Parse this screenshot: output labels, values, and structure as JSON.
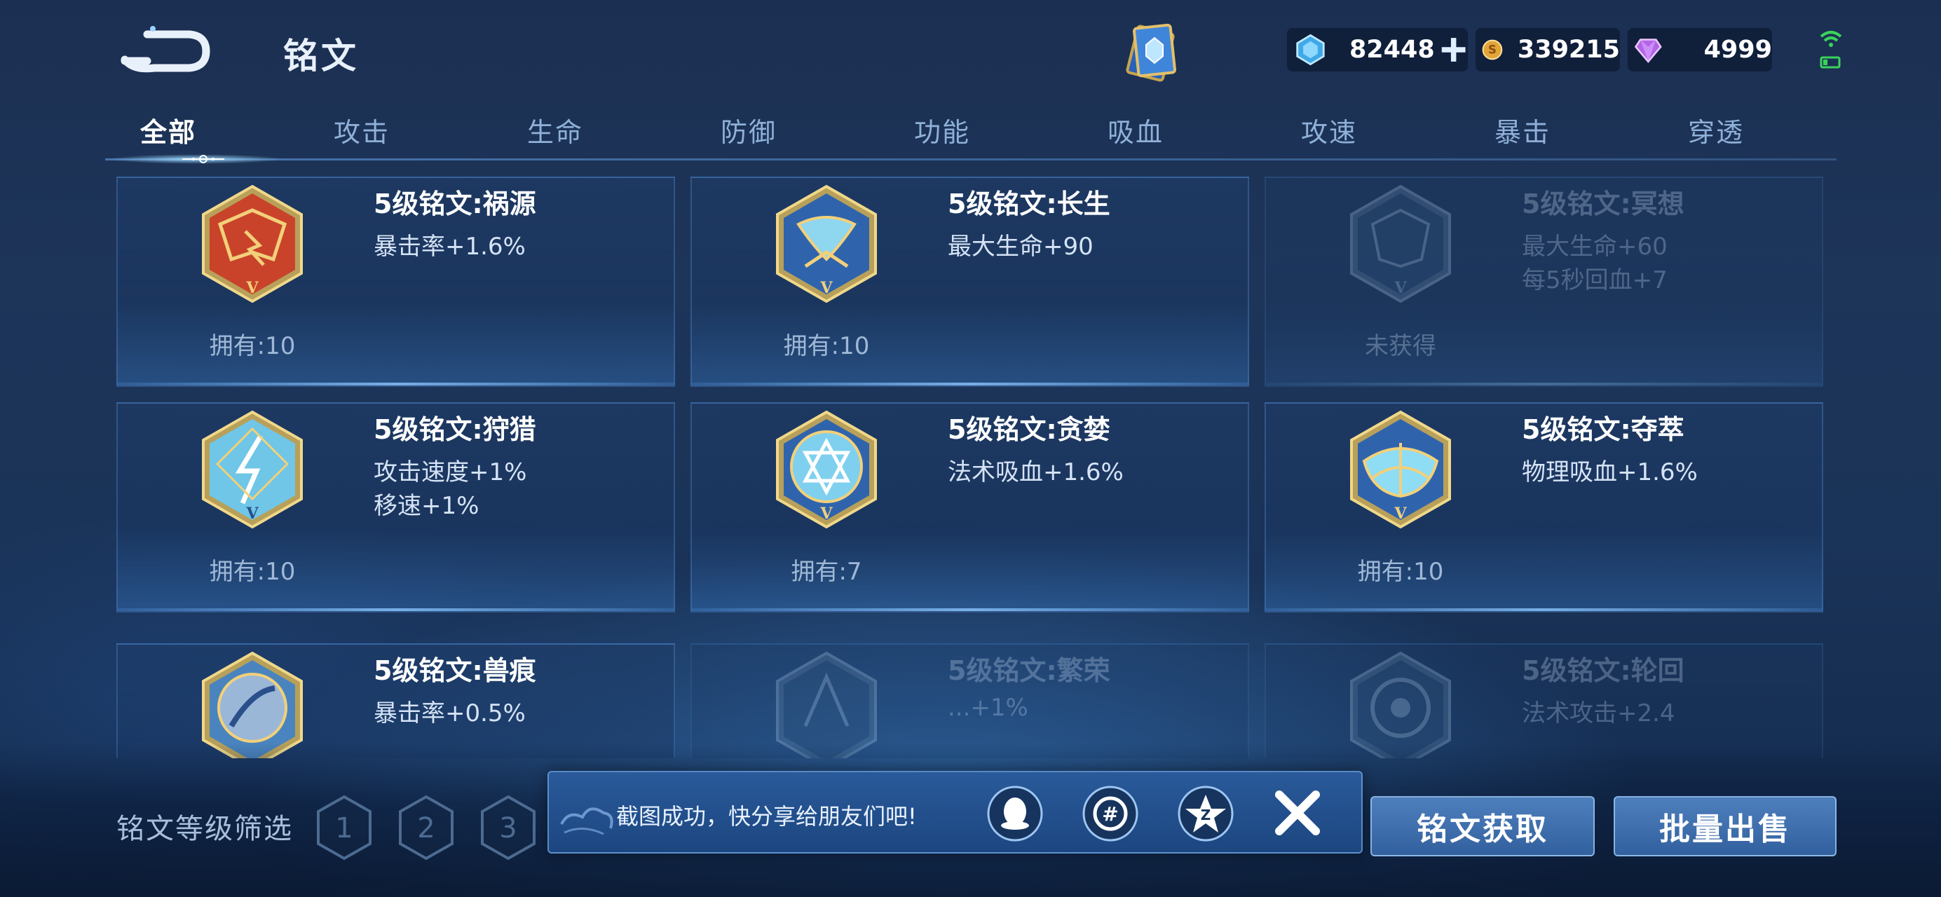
{
  "header": {
    "title": "铭文",
    "currencies": [
      {
        "name": "diamond",
        "value": "82448",
        "icon": "diamond-icon",
        "has_add": true
      },
      {
        "name": "gold",
        "value": "339215",
        "icon": "gold-coin-icon",
        "has_add": false
      },
      {
        "name": "gem",
        "value": "4999",
        "icon": "gem-icon",
        "has_add": false
      }
    ]
  },
  "tabs": [
    "全部",
    "攻击",
    "生命",
    "防御",
    "功能",
    "吸血",
    "攻速",
    "暴击",
    "穿透"
  ],
  "active_tab": "全部",
  "runes": [
    {
      "name": "5级铭文:祸源",
      "stats": [
        "暴击率+1.6%"
      ],
      "owned": "拥有:10",
      "color": "#c9432a"
    },
    {
      "name": "5级铭文:长生",
      "stats": [
        "最大生命+90"
      ],
      "owned": "拥有:10",
      "color": "#3a6fb8"
    },
    {
      "name": "5级铭文:冥想",
      "stats": [
        "最大生命+60",
        "每5秒回血+7"
      ],
      "owned": "未获得",
      "color": "#2f5b8f"
    },
    {
      "name": "5级铭文:狩猎",
      "stats": [
        "攻击速度+1%",
        "移速+1%"
      ],
      "owned": "拥有:10",
      "color": "#6fc6e6"
    },
    {
      "name": "5级铭文:贪婪",
      "stats": [
        "法术吸血+1.6%"
      ],
      "owned": "拥有:7",
      "color": "#6fc6e6"
    },
    {
      "name": "5级铭文:夺萃",
      "stats": [
        "物理吸血+1.6%"
      ],
      "owned": "拥有:10",
      "color": "#6fc6e6"
    },
    {
      "name": "5级铭文:兽痕",
      "stats": [
        "暴击率+0.5%"
      ],
      "owned": "",
      "color": "#5c8fc4"
    },
    {
      "name": "5级铭文:繁荣",
      "stats": [
        "...+1%"
      ],
      "owned": "",
      "color": "#3a6fb8"
    },
    {
      "name": "5级铭文:轮回",
      "stats": [
        "法术攻击+2.4"
      ],
      "owned": "",
      "color": "#3a6fb8"
    }
  ],
  "filter": {
    "label": "铭文等级筛选",
    "levels": [
      "1",
      "2",
      "3"
    ]
  },
  "share": {
    "text": "截图成功，快分享给朋友们吧!",
    "targets": [
      "qq-icon",
      "moments-icon",
      "qzone-icon"
    ]
  },
  "buttons": {
    "acquire": "铭文获取",
    "sell": "批量出售"
  }
}
